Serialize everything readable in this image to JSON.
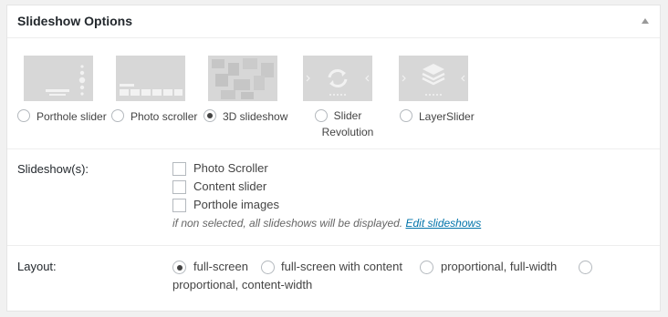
{
  "panel": {
    "title": "Slideshow Options"
  },
  "slideshow_types": [
    {
      "label": "Porthole slider",
      "checked": false
    },
    {
      "label": "Photo scroller",
      "checked": false
    },
    {
      "label": "3D slideshow",
      "checked": true
    },
    {
      "label": "Slider Revolution",
      "checked": false
    },
    {
      "label": "LayerSlider",
      "checked": false
    }
  ],
  "slideshows": {
    "label": "Slideshow(s):",
    "items": [
      {
        "label": "Photo Scroller",
        "checked": false
      },
      {
        "label": "Content slider",
        "checked": false
      },
      {
        "label": "Porthole images",
        "checked": false
      }
    ],
    "hint": "if non selected, all slideshows will be displayed.",
    "link": "Edit slideshows"
  },
  "layout": {
    "label": "Layout:",
    "options": [
      {
        "label": "full-screen",
        "checked": true
      },
      {
        "label": "full-screen with content",
        "checked": false
      },
      {
        "label": "proportional, full-width",
        "checked": false
      },
      {
        "label": "proportional, content-width",
        "checked": false
      }
    ]
  },
  "colors": {
    "thumb": "#d7d7d7",
    "link": "#0073aa"
  }
}
